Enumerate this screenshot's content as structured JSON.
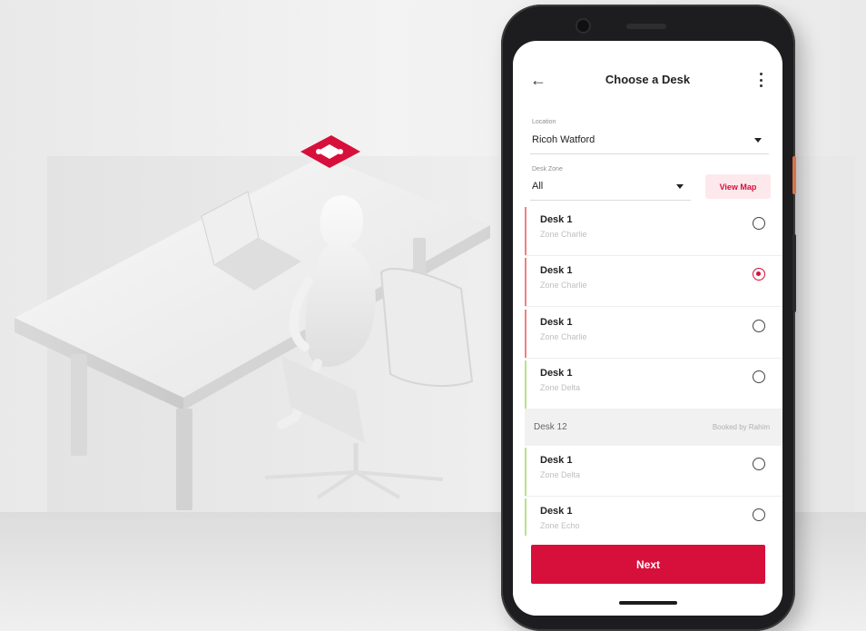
{
  "screen": {
    "title": "Choose a Desk",
    "back_icon": "arrow-left-icon",
    "more_icon": "more-vertical-icon"
  },
  "location": {
    "label": "Location",
    "value": "Ricoh Watford"
  },
  "desk_zone": {
    "label": "Desk Zone",
    "value": "All",
    "view_map_label": "View Map"
  },
  "desks": [
    {
      "name": "Desk 1",
      "zone": "Zone Charlie",
      "selected": false,
      "accent": "#f08080"
    },
    {
      "name": "Desk 1",
      "zone": "Zone Charlie",
      "selected": true,
      "accent": "#f08080"
    },
    {
      "name": "Desk 1",
      "zone": "Zone Charlie",
      "selected": false,
      "accent": "#f08080"
    },
    {
      "name": "Desk 1",
      "zone": "Zone Delta",
      "selected": false,
      "accent": "#b9e28a"
    }
  ],
  "booked": {
    "name": "Desk 12",
    "status": "Booked by Rahim"
  },
  "desks_after": [
    {
      "name": "Desk 1",
      "zone": "Zone Delta",
      "selected": false,
      "accent": "#b9e28a"
    },
    {
      "name": "Desk 1",
      "zone": "Zone Echo",
      "selected": false,
      "accent": "#b9e28a"
    }
  ],
  "actions": {
    "next_label": "Next"
  },
  "colors": {
    "brand": "#d70f3b",
    "brand_light": "#fde8ec"
  }
}
